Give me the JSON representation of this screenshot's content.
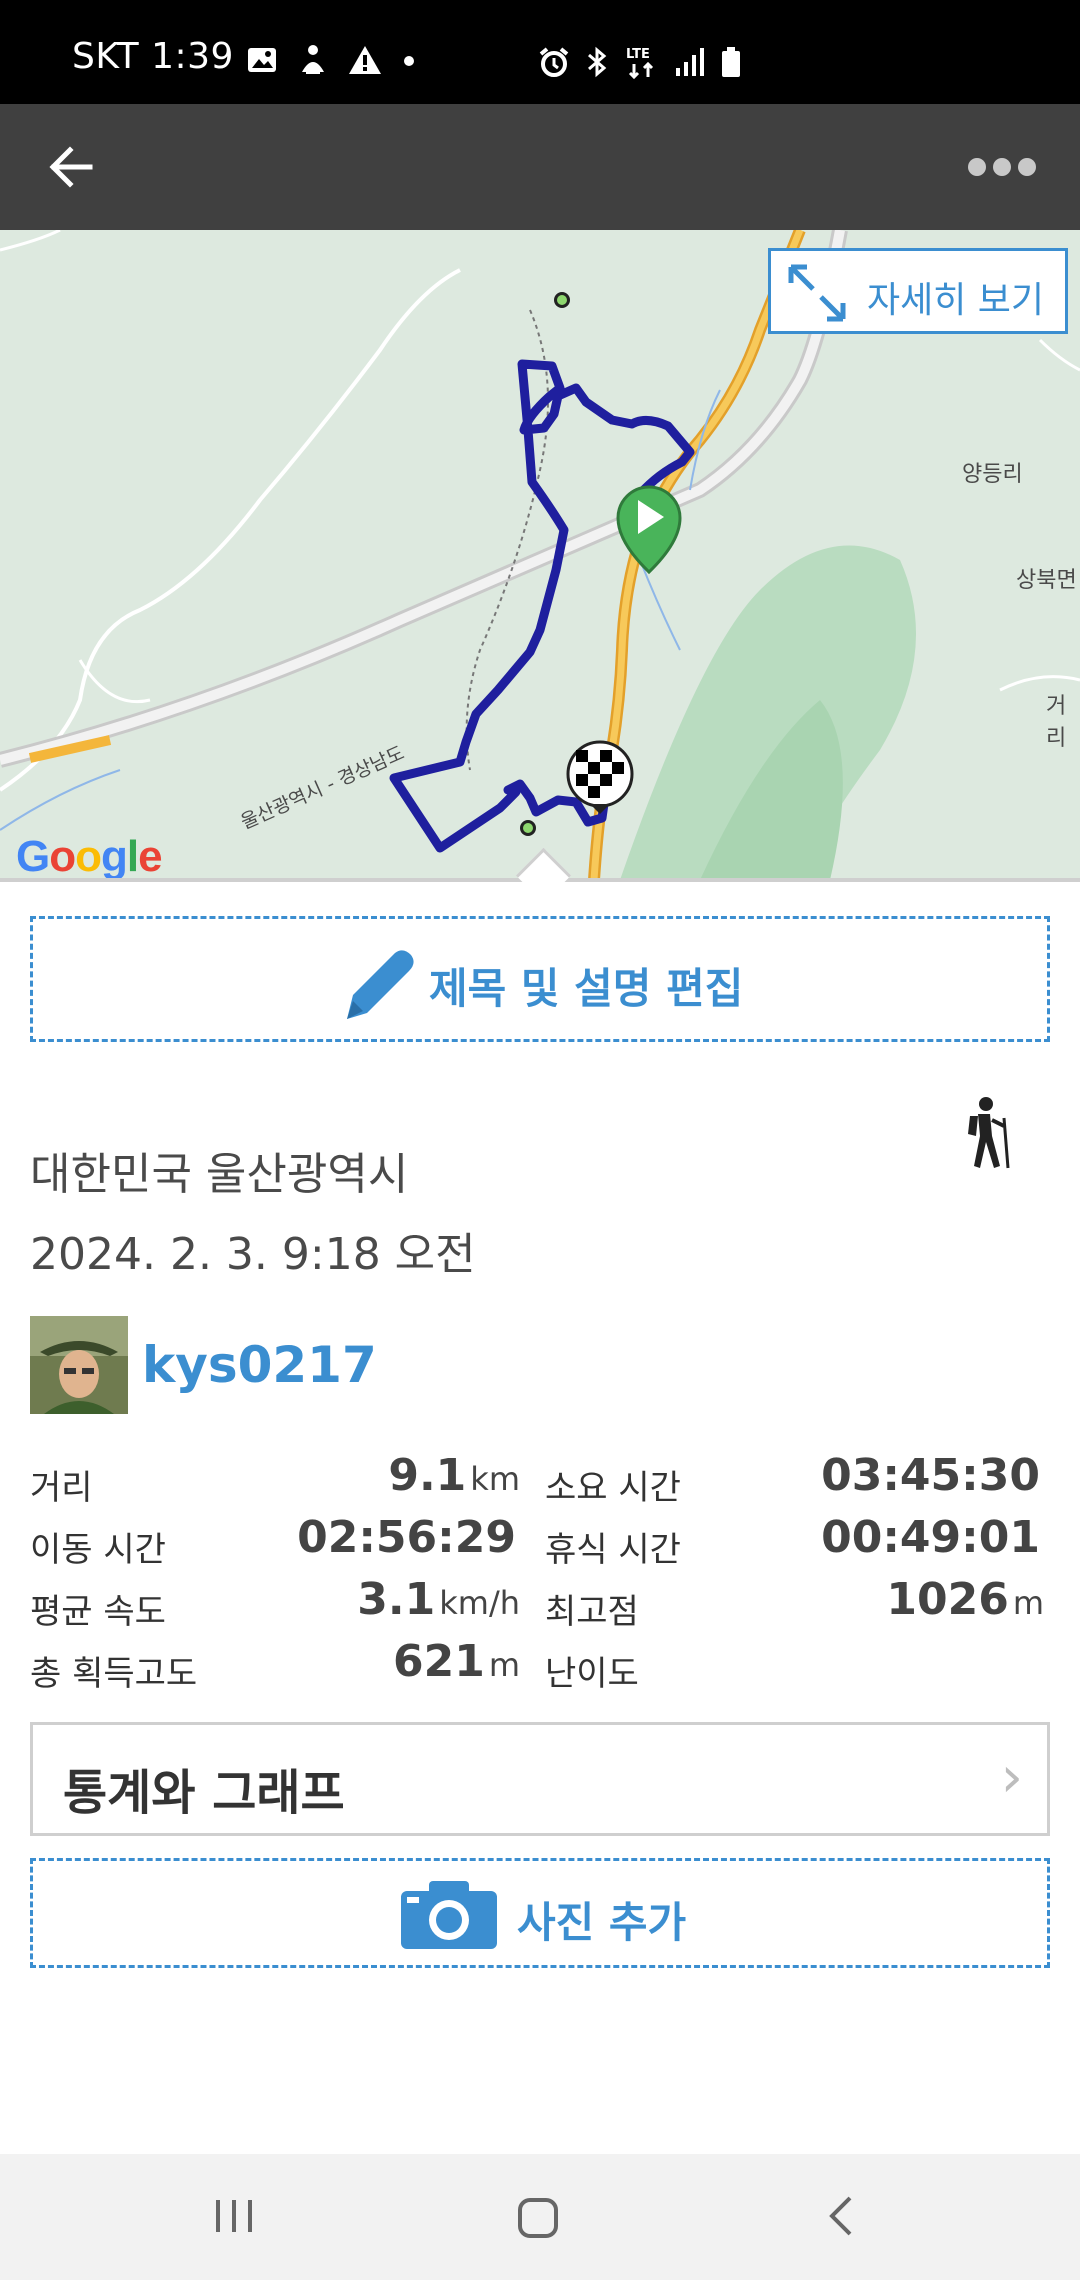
{
  "status_bar": {
    "time": "SKT 1:39",
    "icons_left": [
      "image-icon",
      "accessibility-icon",
      "warning-icon",
      "dot-icon"
    ],
    "icons_right": [
      "alarm-icon",
      "bluetooth-icon",
      "lte-icon",
      "signal-icon",
      "battery-icon"
    ],
    "lte": "LTE"
  },
  "app_bar": {
    "back_icon": "arrow-left-icon",
    "more_icon": "more-horizontal-icon"
  },
  "map": {
    "detail_button_label": "자세히 보기",
    "place_labels": [
      "양등리",
      "상북면",
      "거리",
      "울산광역시 - 경상남도"
    ],
    "attribution": "Google",
    "colors": {
      "track": "#1f1f9e",
      "road": "#f4b63b",
      "land": "#dde9df",
      "forest": "#a9d4b1",
      "start": "#49b45a"
    }
  },
  "edit_button": {
    "label": "제목 및 설명 편집",
    "icon": "pencil-icon"
  },
  "activity": {
    "location": "대한민국 울산광역시",
    "datetime": "2024. 2. 3. 9:18 오전",
    "type_icon": "hiking-icon",
    "username": "kys0217"
  },
  "stats": {
    "rows": [
      {
        "label": "거리",
        "value": "9.1",
        "unit": "km",
        "label2": "소요 시간",
        "value2": "03:45:30",
        "unit2": ""
      },
      {
        "label": "이동 시간",
        "value": "02:56:29",
        "unit": "",
        "label2": "휴식 시간",
        "value2": "00:49:01",
        "unit2": ""
      },
      {
        "label": "평균 속도",
        "value": "3.1",
        "unit": "km/h",
        "label2": "최고점",
        "value2": "1026",
        "unit2": "m"
      },
      {
        "label": "총 획득고도",
        "value": "621",
        "unit": "m",
        "label2": "난이도",
        "value2": "",
        "unit2": ""
      }
    ]
  },
  "graph_button": {
    "label": "통계와 그래프",
    "chevron": "›"
  },
  "photo_button": {
    "label": "사진 추가",
    "icon": "camera-icon"
  },
  "nav_bar": {
    "items": [
      "recents-icon",
      "home-icon",
      "back-icon"
    ]
  },
  "accent_color": "#3b8ed0"
}
